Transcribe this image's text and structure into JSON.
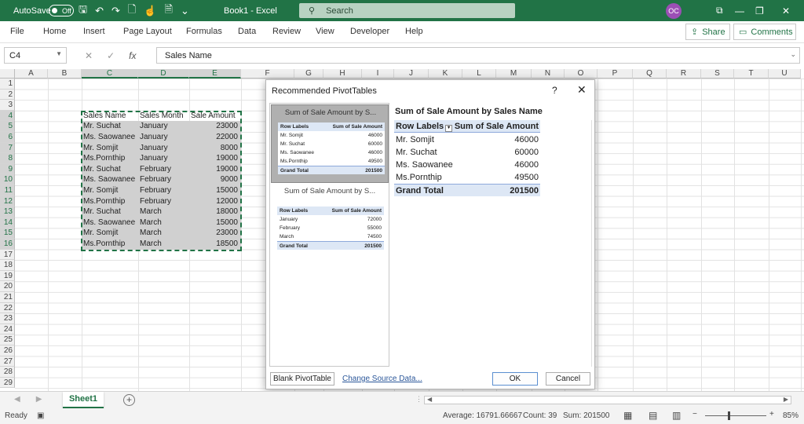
{
  "titlebar": {
    "autosave_label": "AutoSave",
    "autosave_state": "Off",
    "doc_title": "Book1  -  Excel",
    "search_placeholder": "Search",
    "user_initials": "OC"
  },
  "ribbon": {
    "tabs": [
      "File",
      "Home",
      "Insert",
      "Page Layout",
      "Formulas",
      "Data",
      "Review",
      "View",
      "Developer",
      "Help"
    ],
    "share_label": "Share",
    "comments_label": "Comments"
  },
  "formula_bar": {
    "name_box": "C4",
    "fx_label": "fx",
    "formula_value": "Sales Name"
  },
  "grid": {
    "columns": [
      "A",
      "B",
      "C",
      "D",
      "E",
      "F",
      "G",
      "H",
      "I",
      "J",
      "K",
      "L",
      "M",
      "N",
      "O",
      "P",
      "Q",
      "R",
      "S",
      "T",
      "U"
    ],
    "rows": [
      "1",
      "2",
      "3",
      "4",
      "5",
      "6",
      "7",
      "8",
      "9",
      "10",
      "11",
      "12",
      "13",
      "14",
      "15",
      "16",
      "17",
      "18",
      "19",
      "20",
      "21",
      "22",
      "23",
      "24",
      "25",
      "26",
      "27",
      "28",
      "29"
    ],
    "header": [
      "Sales Name",
      "Sales Month",
      "Sale Amount"
    ],
    "data": [
      [
        "Mr. Suchat",
        "January",
        "23000"
      ],
      [
        "Ms. Saowanee",
        "January",
        "22000"
      ],
      [
        "Mr. Somjit",
        "January",
        "8000"
      ],
      [
        "Ms.Pornthip",
        "January",
        "19000"
      ],
      [
        "Mr. Suchat",
        "February",
        "19000"
      ],
      [
        "Ms. Saowanee",
        "February",
        "9000"
      ],
      [
        "Mr. Somjit",
        "February",
        "15000"
      ],
      [
        "Ms.Pornthip",
        "February",
        "12000"
      ],
      [
        "Mr. Suchat",
        "March",
        "18000"
      ],
      [
        "Ms. Saowanee",
        "March",
        "15000"
      ],
      [
        "Mr. Somjit",
        "March",
        "23000"
      ],
      [
        "Ms.Pornthip",
        "March",
        "18500"
      ]
    ]
  },
  "dialog": {
    "title": "Recommended PivotTables",
    "help": "?",
    "close": "✕",
    "thumbnails": [
      {
        "title": "Sum of Sale Amount by S...",
        "head": [
          "Row Labels",
          "Sum of Sale Amount"
        ],
        "rows": [
          [
            "Mr. Somjit",
            "46000"
          ],
          [
            "Mr. Suchat",
            "60000"
          ],
          [
            "Ms. Saowanee",
            "46000"
          ],
          [
            "Ms.Pornthip",
            "49500"
          ]
        ],
        "total": [
          "Grand Total",
          "201500"
        ]
      },
      {
        "title": "Sum of Sale Amount by S...",
        "head": [
          "Row Labels",
          "Sum of Sale Amount"
        ],
        "rows": [
          [
            "January",
            "72000"
          ],
          [
            "February",
            "55000"
          ],
          [
            "March",
            "74500"
          ]
        ],
        "total": [
          "Grand Total",
          "201500"
        ]
      }
    ],
    "preview": {
      "title": "Sum of Sale Amount by Sales Name",
      "head": [
        "Row Labels",
        "Sum of Sale Amount"
      ],
      "rows": [
        [
          "Mr. Somjit",
          "46000"
        ],
        [
          "Mr. Suchat",
          "60000"
        ],
        [
          "Ms. Saowanee",
          "46000"
        ],
        [
          "Ms.Pornthip",
          "49500"
        ]
      ],
      "total": [
        "Grand Total",
        "201500"
      ]
    },
    "blank_button": "Blank PivotTable",
    "change_source_link": "Change Source Data...",
    "ok_button": "OK",
    "cancel_button": "Cancel"
  },
  "sheets": {
    "active": "Sheet1"
  },
  "status": {
    "ready": "Ready",
    "average": "Average: 16791.66667",
    "count": "Count: 39",
    "sum": "Sum: 201500",
    "zoom": "85%"
  },
  "colors": {
    "excel_green": "#217346",
    "pivot_header": "#dde7f5"
  }
}
